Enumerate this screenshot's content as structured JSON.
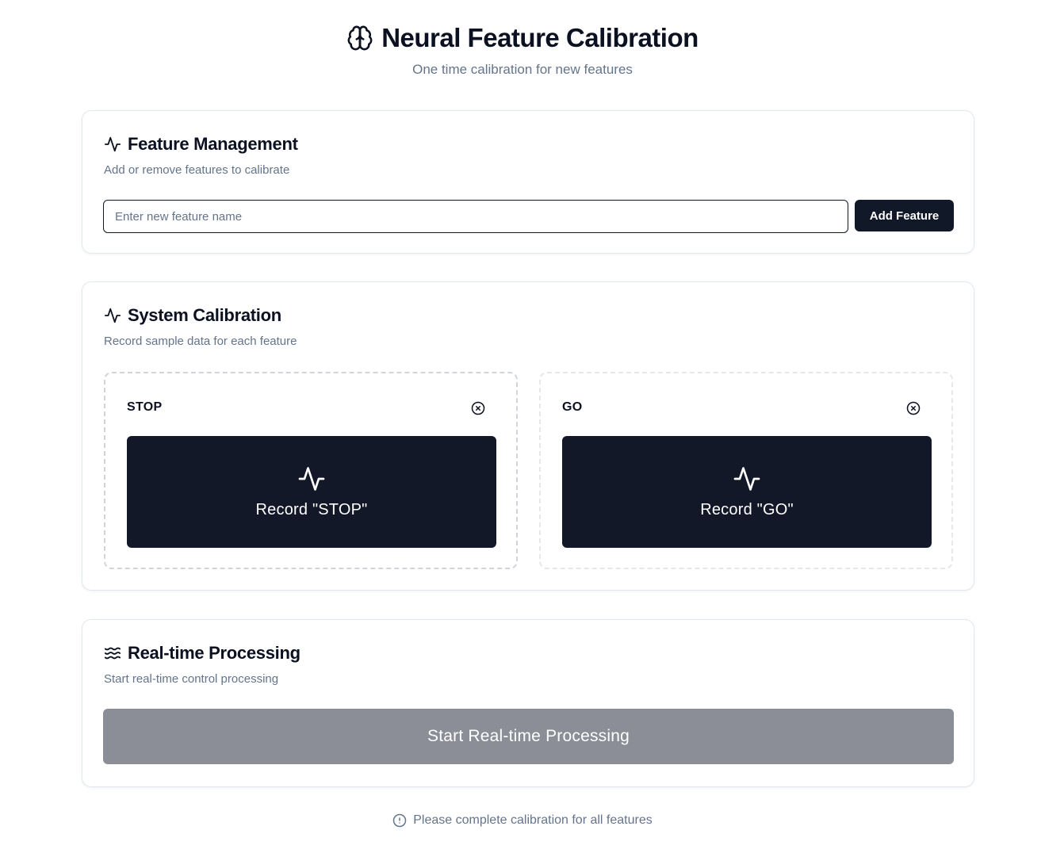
{
  "header": {
    "title": "Neural Feature Calibration",
    "subtitle": "One time calibration for new features",
    "icon": "brain-icon"
  },
  "feature_management": {
    "title": "Feature Management",
    "description": "Add or remove features to calibrate",
    "input_value": "",
    "input_placeholder": "Enter new feature name",
    "add_button_label": "Add Feature",
    "icon": "activity-icon"
  },
  "system_calibration": {
    "title": "System Calibration",
    "description": "Record sample data for each feature",
    "icon": "activity-icon",
    "features": [
      {
        "name": "STOP",
        "record_label": "Record \"STOP\"",
        "remove_icon": "close-circle-icon",
        "record_icon": "activity-icon"
      },
      {
        "name": "GO",
        "record_label": "Record \"GO\"",
        "remove_icon": "close-circle-icon",
        "record_icon": "activity-icon"
      }
    ]
  },
  "realtime_processing": {
    "title": "Real-time Processing",
    "description": "Start real-time control processing",
    "start_button_label": "Start Real-time Processing",
    "start_button_state": "disabled",
    "icon": "waves-icon"
  },
  "status": {
    "message": "Please complete calibration for all features",
    "icon": "info-icon"
  },
  "colors": {
    "primary": "#111827",
    "record_button": "#131829",
    "disabled_button": "#8b8e96",
    "muted_text": "#64748b",
    "border": "#e2e8f0"
  }
}
